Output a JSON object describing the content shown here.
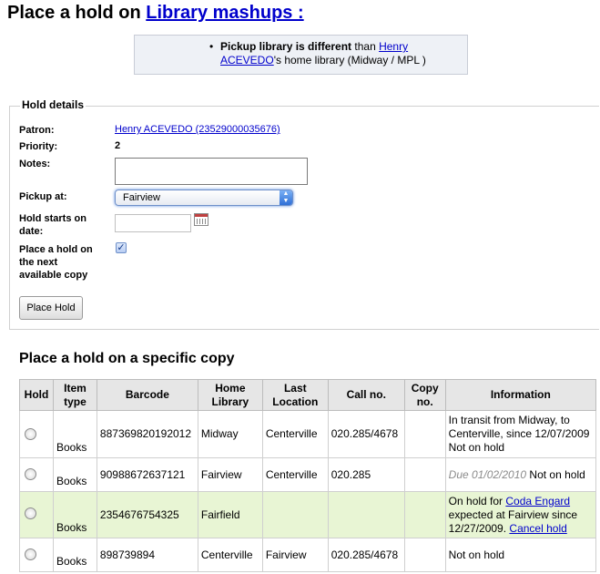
{
  "page": {
    "title_prefix": "Place a hold on ",
    "title_link": "Library mashups :"
  },
  "message": {
    "bullet": "•",
    "bold": "Pickup library is different",
    "middle": " than ",
    "link": "Henry ACEVEDO",
    "suffix": "'s home library (Midway / MPL )"
  },
  "hold_details": {
    "legend": "Hold details",
    "patron_label": "Patron:",
    "patron_value": "Henry ACEVEDO (23529000035676)",
    "priority_label": "Priority:",
    "priority_value": "2",
    "notes_label": "Notes:",
    "notes_value": "",
    "pickup_label": "Pickup at:",
    "pickup_value": "Fairview",
    "starts_label_1": "Hold starts on",
    "starts_label_2": "date:",
    "starts_value": "",
    "next_label_1": "Place a hold on",
    "next_label_2": "the next",
    "next_label_3": "available copy",
    "next_checked": "✓",
    "submit_label": "Place Hold"
  },
  "specific": {
    "heading": "Place a hold on a specific copy",
    "columns": {
      "hold": "Hold",
      "item_type_1": "Item",
      "item_type_2": "type",
      "barcode": "Barcode",
      "home_1": "Home",
      "home_2": "Library",
      "last_1": "Last",
      "last_2": "Location",
      "call": "Call no.",
      "copy_1": "Copy",
      "copy_2": "no.",
      "info": "Information"
    },
    "rows": [
      {
        "item_type": "Books",
        "barcode": "887369820192012",
        "home": "Midway",
        "last": "Centerville",
        "call": "020.285/4678",
        "copy": "",
        "info_1": "In transit from Midway, to",
        "info_2": "Centerville, since 12/07/2009",
        "info_3": "Not on hold"
      },
      {
        "item_type": "Books",
        "barcode": "90988672637121",
        "home": "Fairview",
        "last": "Centerville",
        "call": "020.285",
        "copy": "",
        "info_due": "Due 01/02/2010",
        "info_rest": " Not on hold"
      },
      {
        "item_type": "Books",
        "barcode": "2354676754325",
        "home": "Fairfield",
        "last": "",
        "call": "",
        "copy": "",
        "info_1": "On hold for ",
        "info_link": "Coda Engard",
        "info_2": "expected at Fairview since",
        "info_3": "12/27/2009. ",
        "info_cancel": "Cancel hold"
      },
      {
        "item_type": "Books",
        "barcode": "898739894",
        "home": "Centerville",
        "last": "Fairview",
        "call": "020.285/4678",
        "copy": "",
        "info": "Not on hold"
      }
    ]
  }
}
